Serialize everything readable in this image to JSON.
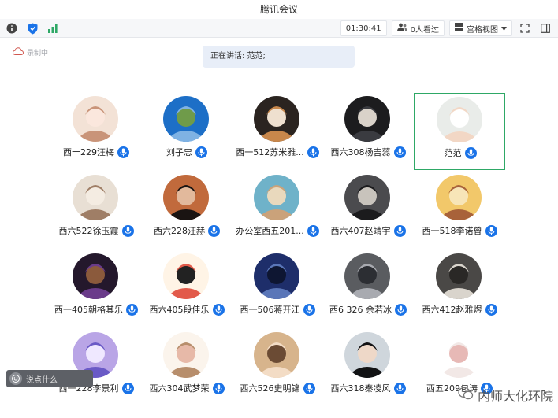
{
  "window": {
    "title": "腾讯会议"
  },
  "toolbar": {
    "time": "01:30:41",
    "viewers": "0人看过",
    "view_mode": "宫格视图"
  },
  "recording": {
    "label": "录制中"
  },
  "speaking": {
    "label": "正在讲话: 范范;"
  },
  "colors": {
    "mic_blue": "#1a73e8",
    "active_border": "#2ea866",
    "banner_bg": "#e8eef8"
  },
  "participants": [
    {
      "name": "西十229汪梅",
      "avatar": "cartoon-girl",
      "active": false
    },
    {
      "name": "刘子忠",
      "avatar": "campus-sky",
      "active": false
    },
    {
      "name": "西一512苏米雅...",
      "avatar": "shiba-dog",
      "active": false
    },
    {
      "name": "西六308杨吉蕊",
      "avatar": "dark-portrait",
      "active": false
    },
    {
      "name": "范范",
      "avatar": "speaker-woman",
      "active": true
    },
    {
      "name": "西六522徐玉霞",
      "avatar": "anime-girl",
      "active": false
    },
    {
      "name": "西六228汪赫",
      "avatar": "young-man",
      "active": false
    },
    {
      "name": "办公室西五201...",
      "avatar": "beach-girl",
      "active": false
    },
    {
      "name": "西六407赵靖宇",
      "avatar": "sunglasses",
      "active": false
    },
    {
      "name": "西一518李诺曾",
      "avatar": "cartoon-lion",
      "active": false
    },
    {
      "name": "西一405朝格其乐",
      "avatar": "basketball",
      "active": false
    },
    {
      "name": "西六405段佳乐",
      "avatar": "cartoon-kid",
      "active": false
    },
    {
      "name": "西一506蒋开江",
      "avatar": "blue-night",
      "active": false
    },
    {
      "name": "西6 326 余若冰",
      "avatar": "grey-street",
      "active": false
    },
    {
      "name": "西六412赵雅煜",
      "avatar": "sketch-boy",
      "active": false
    },
    {
      "name": "西一228李景利",
      "avatar": "purple-anime",
      "active": false
    },
    {
      "name": "西六304武梦荣",
      "avatar": "doodle-girl",
      "active": false
    },
    {
      "name": "西六526史明锦",
      "avatar": "blonde-woman",
      "active": false
    },
    {
      "name": "西六318秦凌风",
      "avatar": "black-hair-girl",
      "active": false
    },
    {
      "name": "西五209包涛",
      "avatar": "white-bunny",
      "active": false
    }
  ],
  "chat": {
    "placeholder": "说点什么"
  },
  "watermark": {
    "text": "内师大化环院"
  }
}
